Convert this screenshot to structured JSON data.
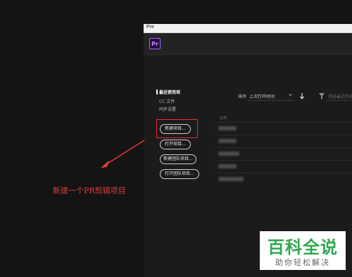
{
  "window": {
    "title": "Pre"
  },
  "app": {
    "logo_text": "Pr"
  },
  "sort": {
    "label": "排序",
    "value": "上次打开时间",
    "filter_placeholder": "筛选最近的项目"
  },
  "nav": {
    "items": [
      {
        "label": "最近使用项",
        "active": true
      },
      {
        "label": "CC 文件",
        "active": false
      },
      {
        "label": "同步设置",
        "active": false
      }
    ]
  },
  "buttons": {
    "new_project": "新建项目...",
    "open_project": "打开项目...",
    "new_team_project": "新建团队项目...",
    "open_team_project": "打开团队项目..."
  },
  "list": {
    "header": "名称",
    "rows": 5
  },
  "annotation": {
    "text": "新建一个PR剪辑项目",
    "color": "#e03a3a"
  },
  "watermark": {
    "title": "百科全说",
    "subtitle": "助你轻松解决",
    "color": "#2fa84f"
  }
}
